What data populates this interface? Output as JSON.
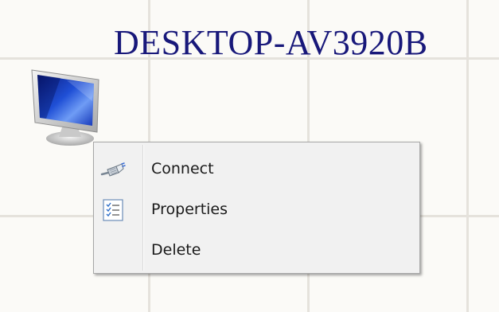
{
  "canvas": {
    "node_title": "DESKTOP-AV3920B",
    "node_icon": "computer-monitor-icon",
    "title_color": "#18187a"
  },
  "context_menu": {
    "items": [
      {
        "label": "Connect",
        "icon": "network-cable-plug-icon"
      },
      {
        "label": "Properties",
        "icon": "properties-checklist-icon"
      },
      {
        "label": "Delete",
        "icon": null
      }
    ]
  }
}
